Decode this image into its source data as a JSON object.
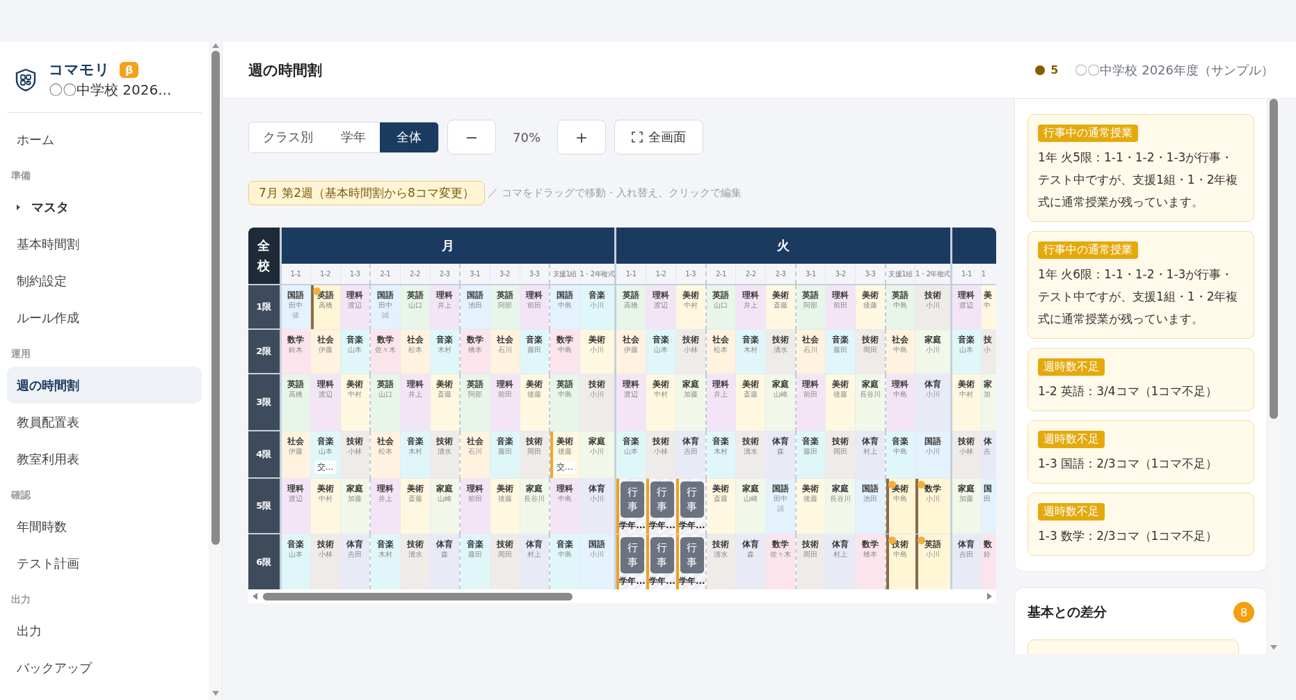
{
  "sidebar": {
    "app_name": "コマモリ",
    "badge": "β",
    "school": "〇〇中学校 2026...",
    "items": [
      {
        "kind": "link",
        "label": "ホーム",
        "selected": false
      },
      {
        "kind": "section",
        "label": "準備"
      },
      {
        "kind": "group",
        "label": "マスタ",
        "expanded": false,
        "selected": false
      },
      {
        "kind": "link",
        "label": "基本時間割",
        "selected": false
      },
      {
        "kind": "link",
        "label": "制約設定",
        "selected": false
      },
      {
        "kind": "link",
        "label": "ルール作成",
        "selected": false
      },
      {
        "kind": "section",
        "label": "運用"
      },
      {
        "kind": "link",
        "label": "週の時間割",
        "selected": true
      },
      {
        "kind": "link",
        "label": "教員配置表",
        "selected": false
      },
      {
        "kind": "link",
        "label": "教室利用表",
        "selected": false
      },
      {
        "kind": "section",
        "label": "確認"
      },
      {
        "kind": "link",
        "label": "年間時数",
        "selected": false
      },
      {
        "kind": "link",
        "label": "テスト計画",
        "selected": false
      },
      {
        "kind": "section",
        "label": "出力"
      },
      {
        "kind": "link",
        "label": "出力",
        "selected": false
      },
      {
        "kind": "link",
        "label": "バックアップ",
        "selected": false
      }
    ]
  },
  "header": {
    "title": "週の時間割",
    "warning_count": "5",
    "school": "〇〇中学校 2026年度（サンプル）"
  },
  "view_modes": [
    {
      "label": "クラス別",
      "selected": false
    },
    {
      "label": "学年",
      "selected": false
    },
    {
      "label": "全体",
      "selected": true
    }
  ],
  "zoom": {
    "decrease": "−",
    "value": "70%",
    "increase": "+"
  },
  "fullscreen_button": "全画面",
  "week_label": "7月 第2週（基本時間割から8コマ変更）",
  "hint": "／ コマをドラッグで移動・入れ替え、クリックで編集",
  "timetable": {
    "corner": "全校",
    "periods": [
      "1限",
      "2限",
      "3限",
      "4限",
      "5限",
      "6限"
    ],
    "days": [
      {
        "label": "月",
        "groups": [
          [
            {
              "class": "1-1",
              "cells": [
                {
                  "kind": "lesson",
                  "subject": "国語",
                  "teacher": "田中",
                  "note": "健",
                  "color": "#e3f2fd",
                  "marked": false
                },
                {
                  "kind": "lesson",
                  "subject": "数学",
                  "teacher": "鈴木",
                  "color": "#fce4ec",
                  "marked": false
                },
                {
                  "kind": "lesson",
                  "subject": "英語",
                  "teacher": "高橋",
                  "color": "#e8f5e9",
                  "marked": false
                },
                {
                  "kind": "lesson",
                  "subject": "社会",
                  "teacher": "伊藤",
                  "color": "#fff3e0",
                  "marked": false
                },
                {
                  "kind": "lesson",
                  "subject": "理科",
                  "teacher": "渡辺",
                  "color": "#f3e5f5",
                  "marked": false
                },
                {
                  "kind": "lesson",
                  "subject": "音楽",
                  "teacher": "山本",
                  "color": "#e0f7fa",
                  "marked": false
                }
              ]
            },
            {
              "class": "1-2",
              "cells": [
                {
                  "kind": "lesson",
                  "subject": "英語",
                  "teacher": "高橋",
                  "color": "#fff6d6",
                  "marked": true,
                  "edited": true
                },
                {
                  "kind": "lesson",
                  "subject": "社会",
                  "teacher": "伊藤",
                  "color": "#fff3e0",
                  "marked": false
                },
                {
                  "kind": "lesson",
                  "subject": "理科",
                  "teacher": "渡辺",
                  "color": "#f3e5f5",
                  "marked": false
                },
                {
                  "kind": "lesson",
                  "subject": "音楽",
                  "teacher": "山本",
                  "chip": "交...",
                  "color": "#e0f7fa",
                  "marked": false
                },
                {
                  "kind": "lesson",
                  "subject": "美術",
                  "teacher": "中村",
                  "color": "#fff8e1",
                  "marked": false
                },
                {
                  "kind": "lesson",
                  "subject": "技術",
                  "teacher": "小林",
                  "color": "#efebe9",
                  "marked": false
                }
              ]
            },
            {
              "class": "1-3",
              "cells": [
                {
                  "kind": "lesson",
                  "subject": "理科",
                  "teacher": "渡辺",
                  "color": "#f3e5f5",
                  "marked": false
                },
                {
                  "kind": "lesson",
                  "subject": "音楽",
                  "teacher": "山本",
                  "color": "#e0f7fa",
                  "marked": false
                },
                {
                  "kind": "lesson",
                  "subject": "美術",
                  "teacher": "中村",
                  "color": "#fff8e1",
                  "marked": false
                },
                {
                  "kind": "lesson",
                  "subject": "技術",
                  "teacher": "小林",
                  "color": "#efebe9",
                  "marked": false
                },
                {
                  "kind": "lesson",
                  "subject": "家庭",
                  "teacher": "加藤",
                  "color": "#f1f8e9",
                  "marked": false
                },
                {
                  "kind": "lesson",
                  "subject": "体育",
                  "teacher": "吉田",
                  "color": "#e8eaf6",
                  "marked": false
                }
              ]
            }
          ],
          [
            {
              "class": "2-1",
              "cells": [
                {
                  "kind": "lesson",
                  "subject": "国語",
                  "teacher": "田中",
                  "note": "誠",
                  "color": "#e3f2fd",
                  "marked": false
                },
                {
                  "kind": "lesson",
                  "subject": "数学",
                  "teacher": "佐々木",
                  "color": "#fce4ec",
                  "marked": false
                },
                {
                  "kind": "lesson",
                  "subject": "英語",
                  "teacher": "山口",
                  "color": "#e8f5e9",
                  "marked": false
                },
                {
                  "kind": "lesson",
                  "subject": "社会",
                  "teacher": "松本",
                  "color": "#fff3e0",
                  "marked": false
                },
                {
                  "kind": "lesson",
                  "subject": "理科",
                  "teacher": "井上",
                  "color": "#f3e5f5",
                  "marked": false
                },
                {
                  "kind": "lesson",
                  "subject": "音楽",
                  "teacher": "木村",
                  "color": "#e0f7fa",
                  "marked": false
                }
              ]
            },
            {
              "class": "2-2",
              "cells": [
                {
                  "kind": "lesson",
                  "subject": "英語",
                  "teacher": "山口",
                  "color": "#e8f5e9",
                  "marked": false
                },
                {
                  "kind": "lesson",
                  "subject": "社会",
                  "teacher": "松本",
                  "color": "#fff3e0",
                  "marked": false
                },
                {
                  "kind": "lesson",
                  "subject": "理科",
                  "teacher": "井上",
                  "color": "#f3e5f5",
                  "marked": false
                },
                {
                  "kind": "lesson",
                  "subject": "音楽",
                  "teacher": "木村",
                  "color": "#e0f7fa",
                  "marked": false
                },
                {
                  "kind": "lesson",
                  "subject": "美術",
                  "teacher": "斎藤",
                  "color": "#fff8e1",
                  "marked": false
                },
                {
                  "kind": "lesson",
                  "subject": "技術",
                  "teacher": "清水",
                  "color": "#efebe9",
                  "marked": false
                }
              ]
            },
            {
              "class": "2-3",
              "cells": [
                {
                  "kind": "lesson",
                  "subject": "理科",
                  "teacher": "井上",
                  "color": "#f3e5f5",
                  "marked": false
                },
                {
                  "kind": "lesson",
                  "subject": "音楽",
                  "teacher": "木村",
                  "color": "#e0f7fa",
                  "marked": false
                },
                {
                  "kind": "lesson",
                  "subject": "美術",
                  "teacher": "斎藤",
                  "color": "#fff8e1",
                  "marked": false
                },
                {
                  "kind": "lesson",
                  "subject": "技術",
                  "teacher": "清水",
                  "color": "#efebe9",
                  "marked": false
                },
                {
                  "kind": "lesson",
                  "subject": "家庭",
                  "teacher": "山崎",
                  "color": "#f1f8e9",
                  "marked": false
                },
                {
                  "kind": "lesson",
                  "subject": "体育",
                  "teacher": "森",
                  "color": "#e8eaf6",
                  "marked": false
                }
              ]
            }
          ],
          [
            {
              "class": "3-1",
              "cells": [
                {
                  "kind": "lesson",
                  "subject": "国語",
                  "teacher": "池田",
                  "color": "#e3f2fd",
                  "marked": false
                },
                {
                  "kind": "lesson",
                  "subject": "数学",
                  "teacher": "橋本",
                  "color": "#fce4ec",
                  "marked": false
                },
                {
                  "kind": "lesson",
                  "subject": "英語",
                  "teacher": "阿部",
                  "color": "#e8f5e9",
                  "marked": false
                },
                {
                  "kind": "lesson",
                  "subject": "社会",
                  "teacher": "石川",
                  "color": "#fff3e0",
                  "marked": false
                },
                {
                  "kind": "lesson",
                  "subject": "理科",
                  "teacher": "前田",
                  "color": "#f3e5f5",
                  "marked": false
                },
                {
                  "kind": "lesson",
                  "subject": "音楽",
                  "teacher": "藤田",
                  "color": "#e0f7fa",
                  "marked": false
                }
              ]
            },
            {
              "class": "3-2",
              "cells": [
                {
                  "kind": "lesson",
                  "subject": "英語",
                  "teacher": "阿部",
                  "color": "#e8f5e9",
                  "marked": false
                },
                {
                  "kind": "lesson",
                  "subject": "社会",
                  "teacher": "石川",
                  "color": "#fff3e0",
                  "marked": false
                },
                {
                  "kind": "lesson",
                  "subject": "理科",
                  "teacher": "前田",
                  "color": "#f3e5f5",
                  "marked": false
                },
                {
                  "kind": "lesson",
                  "subject": "音楽",
                  "teacher": "藤田",
                  "color": "#e0f7fa",
                  "marked": false
                },
                {
                  "kind": "lesson",
                  "subject": "美術",
                  "teacher": "後藤",
                  "color": "#fff8e1",
                  "marked": false
                },
                {
                  "kind": "lesson",
                  "subject": "技術",
                  "teacher": "岡田",
                  "color": "#efebe9",
                  "marked": false
                }
              ]
            },
            {
              "class": "3-3",
              "cells": [
                {
                  "kind": "lesson",
                  "subject": "理科",
                  "teacher": "前田",
                  "color": "#f3e5f5",
                  "marked": false
                },
                {
                  "kind": "lesson",
                  "subject": "音楽",
                  "teacher": "藤田",
                  "color": "#e0f7fa",
                  "marked": false
                },
                {
                  "kind": "lesson",
                  "subject": "美術",
                  "teacher": "後藤",
                  "color": "#fff8e1",
                  "marked": false
                },
                {
                  "kind": "lesson",
                  "subject": "技術",
                  "teacher": "岡田",
                  "color": "#efebe9",
                  "marked": false
                },
                {
                  "kind": "lesson",
                  "subject": "家庭",
                  "teacher": "長谷川",
                  "color": "#f1f8e9",
                  "marked": false
                },
                {
                  "kind": "lesson",
                  "subject": "体育",
                  "teacher": "村上",
                  "color": "#e8eaf6",
                  "marked": false
                }
              ]
            }
          ],
          [
            {
              "class": "支援1組",
              "cells": [
                {
                  "kind": "lesson",
                  "subject": "国語",
                  "teacher": "中島",
                  "color": "#e3f2fd",
                  "marked": false
                },
                {
                  "kind": "lesson",
                  "subject": "数学",
                  "teacher": "中島",
                  "color": "#fce4ec",
                  "marked": false
                },
                {
                  "kind": "lesson",
                  "subject": "英語",
                  "teacher": "中島",
                  "color": "#e8f5e9",
                  "marked": false
                },
                {
                  "kind": "lesson",
                  "subject": "美術",
                  "teacher": "後藤",
                  "chip": "交...",
                  "color": "#fff8e1",
                  "marked": false,
                  "edited": true
                },
                {
                  "kind": "lesson",
                  "subject": "理科",
                  "teacher": "中島",
                  "color": "#f3e5f5",
                  "marked": false
                },
                {
                  "kind": "lesson",
                  "subject": "音楽",
                  "teacher": "中島",
                  "color": "#e0f7fa",
                  "marked": false
                }
              ]
            },
            {
              "class": "1・2年複式",
              "cells": [
                {
                  "kind": "lesson",
                  "subject": "音楽",
                  "teacher": "小川",
                  "color": "#e0f7fa",
                  "marked": false
                },
                {
                  "kind": "lesson",
                  "subject": "美術",
                  "teacher": "小川",
                  "color": "#fff8e1",
                  "marked": false
                },
                {
                  "kind": "lesson",
                  "subject": "技術",
                  "teacher": "小川",
                  "color": "#efebe9",
                  "marked": false
                },
                {
                  "kind": "lesson",
                  "subject": "家庭",
                  "teacher": "小川",
                  "color": "#f1f8e9",
                  "marked": false
                },
                {
                  "kind": "lesson",
                  "subject": "体育",
                  "teacher": "小川",
                  "color": "#e8eaf6",
                  "marked": false
                },
                {
                  "kind": "lesson",
                  "subject": "国語",
                  "teacher": "小川",
                  "color": "#e3f2fd",
                  "marked": false
                }
              ]
            }
          ]
        ]
      },
      {
        "label": "火",
        "groups": [
          [
            {
              "class": "1-1",
              "cells": [
                {
                  "kind": "lesson",
                  "subject": "英語",
                  "teacher": "高橋",
                  "color": "#e8f5e9",
                  "marked": false
                },
                {
                  "kind": "lesson",
                  "subject": "社会",
                  "teacher": "伊藤",
                  "color": "#fff3e0",
                  "marked": false
                },
                {
                  "kind": "lesson",
                  "subject": "理科",
                  "teacher": "渡辺",
                  "color": "#f3e5f5",
                  "marked": false
                },
                {
                  "kind": "lesson",
                  "subject": "音楽",
                  "teacher": "山本",
                  "color": "#e0f7fa",
                  "marked": false
                },
                {
                  "kind": "event",
                  "label": "行事",
                  "caption": "学年..."
                },
                {
                  "kind": "event",
                  "label": "行事",
                  "caption": "学年..."
                }
              ]
            },
            {
              "class": "1-2",
              "cells": [
                {
                  "kind": "lesson",
                  "subject": "理科",
                  "teacher": "渡辺",
                  "color": "#f3e5f5",
                  "marked": false
                },
                {
                  "kind": "lesson",
                  "subject": "音楽",
                  "teacher": "山本",
                  "color": "#e0f7fa",
                  "marked": false
                },
                {
                  "kind": "lesson",
                  "subject": "美術",
                  "teacher": "中村",
                  "color": "#fff8e1",
                  "marked": false
                },
                {
                  "kind": "lesson",
                  "subject": "技術",
                  "teacher": "小林",
                  "color": "#efebe9",
                  "marked": false
                },
                {
                  "kind": "event",
                  "label": "行事",
                  "caption": "学年..."
                },
                {
                  "kind": "event",
                  "label": "行事",
                  "caption": "学年..."
                }
              ]
            },
            {
              "class": "1-3",
              "cells": [
                {
                  "kind": "lesson",
                  "subject": "美術",
                  "teacher": "中村",
                  "color": "#fff8e1",
                  "marked": false
                },
                {
                  "kind": "lesson",
                  "subject": "技術",
                  "teacher": "小林",
                  "color": "#efebe9",
                  "marked": false
                },
                {
                  "kind": "lesson",
                  "subject": "家庭",
                  "teacher": "加藤",
                  "color": "#f1f8e9",
                  "marked": false
                },
                {
                  "kind": "lesson",
                  "subject": "体育",
                  "teacher": "吉田",
                  "color": "#e8eaf6",
                  "marked": false
                },
                {
                  "kind": "event",
                  "label": "行事",
                  "caption": "学年..."
                },
                {
                  "kind": "event",
                  "label": "行事",
                  "caption": "学年..."
                }
              ]
            }
          ],
          [
            {
              "class": "2-1",
              "cells": [
                {
                  "kind": "lesson",
                  "subject": "英語",
                  "teacher": "山口",
                  "color": "#e8f5e9",
                  "marked": false
                },
                {
                  "kind": "lesson",
                  "subject": "社会",
                  "teacher": "松本",
                  "color": "#fff3e0",
                  "marked": false
                },
                {
                  "kind": "lesson",
                  "subject": "理科",
                  "teacher": "井上",
                  "color": "#f3e5f5",
                  "marked": false
                },
                {
                  "kind": "lesson",
                  "subject": "音楽",
                  "teacher": "木村",
                  "color": "#e0f7fa",
                  "marked": false
                },
                {
                  "kind": "lesson",
                  "subject": "美術",
                  "teacher": "斎藤",
                  "color": "#fff8e1",
                  "marked": false
                },
                {
                  "kind": "lesson",
                  "subject": "技術",
                  "teacher": "清水",
                  "color": "#efebe9",
                  "marked": false
                }
              ]
            },
            {
              "class": "2-2",
              "cells": [
                {
                  "kind": "lesson",
                  "subject": "理科",
                  "teacher": "井上",
                  "color": "#f3e5f5",
                  "marked": false
                },
                {
                  "kind": "lesson",
                  "subject": "音楽",
                  "teacher": "木村",
                  "color": "#e0f7fa",
                  "marked": false
                },
                {
                  "kind": "lesson",
                  "subject": "美術",
                  "teacher": "斎藤",
                  "color": "#fff8e1",
                  "marked": false
                },
                {
                  "kind": "lesson",
                  "subject": "技術",
                  "teacher": "清水",
                  "color": "#efebe9",
                  "marked": false
                },
                {
                  "kind": "lesson",
                  "subject": "家庭",
                  "teacher": "山崎",
                  "color": "#f1f8e9",
                  "marked": false
                },
                {
                  "kind": "lesson",
                  "subject": "体育",
                  "teacher": "森",
                  "color": "#e8eaf6",
                  "marked": false
                }
              ]
            },
            {
              "class": "2-3",
              "cells": [
                {
                  "kind": "lesson",
                  "subject": "美術",
                  "teacher": "斎藤",
                  "color": "#fff8e1",
                  "marked": false
                },
                {
                  "kind": "lesson",
                  "subject": "技術",
                  "teacher": "清水",
                  "color": "#efebe9",
                  "marked": false
                },
                {
                  "kind": "lesson",
                  "subject": "家庭",
                  "teacher": "山崎",
                  "color": "#f1f8e9",
                  "marked": false
                },
                {
                  "kind": "lesson",
                  "subject": "体育",
                  "teacher": "森",
                  "color": "#e8eaf6",
                  "marked": false
                },
                {
                  "kind": "lesson",
                  "subject": "国語",
                  "teacher": "田中",
                  "note": "誠",
                  "color": "#e3f2fd",
                  "marked": false
                },
                {
                  "kind": "lesson",
                  "subject": "数学",
                  "teacher": "佐々木",
                  "color": "#fce4ec",
                  "marked": false
                }
              ]
            }
          ],
          [
            {
              "class": "3-1",
              "cells": [
                {
                  "kind": "lesson",
                  "subject": "英語",
                  "teacher": "阿部",
                  "color": "#e8f5e9",
                  "marked": false
                },
                {
                  "kind": "lesson",
                  "subject": "社会",
                  "teacher": "石川",
                  "color": "#fff3e0",
                  "marked": false
                },
                {
                  "kind": "lesson",
                  "subject": "理科",
                  "teacher": "前田",
                  "color": "#f3e5f5",
                  "marked": false
                },
                {
                  "kind": "lesson",
                  "subject": "音楽",
                  "teacher": "藤田",
                  "color": "#e0f7fa",
                  "marked": false
                },
                {
                  "kind": "lesson",
                  "subject": "美術",
                  "teacher": "後藤",
                  "color": "#fff8e1",
                  "marked": false
                },
                {
                  "kind": "lesson",
                  "subject": "技術",
                  "teacher": "岡田",
                  "color": "#efebe9",
                  "marked": false
                }
              ]
            },
            {
              "class": "3-2",
              "cells": [
                {
                  "kind": "lesson",
                  "subject": "理科",
                  "teacher": "前田",
                  "color": "#f3e5f5",
                  "marked": false
                },
                {
                  "kind": "lesson",
                  "subject": "音楽",
                  "teacher": "藤田",
                  "color": "#e0f7fa",
                  "marked": false
                },
                {
                  "kind": "lesson",
                  "subject": "美術",
                  "teacher": "後藤",
                  "color": "#fff8e1",
                  "marked": false
                },
                {
                  "kind": "lesson",
                  "subject": "技術",
                  "teacher": "岡田",
                  "color": "#efebe9",
                  "marked": false
                },
                {
                  "kind": "lesson",
                  "subject": "家庭",
                  "teacher": "長谷川",
                  "color": "#f1f8e9",
                  "marked": false
                },
                {
                  "kind": "lesson",
                  "subject": "体育",
                  "teacher": "村上",
                  "color": "#e8eaf6",
                  "marked": false
                }
              ]
            },
            {
              "class": "3-3",
              "cells": [
                {
                  "kind": "lesson",
                  "subject": "美術",
                  "teacher": "後藤",
                  "color": "#fff8e1",
                  "marked": false
                },
                {
                  "kind": "lesson",
                  "subject": "技術",
                  "teacher": "岡田",
                  "color": "#efebe9",
                  "marked": false
                },
                {
                  "kind": "lesson",
                  "subject": "家庭",
                  "teacher": "長谷川",
                  "color": "#f1f8e9",
                  "marked": false
                },
                {
                  "kind": "lesson",
                  "subject": "体育",
                  "teacher": "村上",
                  "color": "#e8eaf6",
                  "marked": false
                },
                {
                  "kind": "lesson",
                  "subject": "国語",
                  "teacher": "池田",
                  "color": "#e3f2fd",
                  "marked": false
                },
                {
                  "kind": "lesson",
                  "subject": "数学",
                  "teacher": "橋本",
                  "color": "#fce4ec",
                  "marked": false
                }
              ]
            }
          ],
          [
            {
              "class": "支援1組",
              "cells": [
                {
                  "kind": "lesson",
                  "subject": "英語",
                  "teacher": "中島",
                  "color": "#e8f5e9",
                  "marked": false
                },
                {
                  "kind": "lesson",
                  "subject": "社会",
                  "teacher": "中島",
                  "color": "#fff3e0",
                  "marked": false
                },
                {
                  "kind": "lesson",
                  "subject": "理科",
                  "teacher": "中島",
                  "color": "#f3e5f5",
                  "marked": false
                },
                {
                  "kind": "lesson",
                  "subject": "音楽",
                  "teacher": "中島",
                  "color": "#e0f7fa",
                  "marked": false
                },
                {
                  "kind": "lesson",
                  "subject": "美術",
                  "teacher": "中島",
                  "color": "#fff6d6",
                  "marked": true,
                  "edited": true
                },
                {
                  "kind": "lesson",
                  "subject": "技術",
                  "teacher": "中島",
                  "color": "#fff6d6",
                  "marked": true,
                  "edited": true
                }
              ]
            },
            {
              "class": "1・2年複式",
              "cells": [
                {
                  "kind": "lesson",
                  "subject": "技術",
                  "teacher": "小川",
                  "color": "#efebe9",
                  "marked": false
                },
                {
                  "kind": "lesson",
                  "subject": "家庭",
                  "teacher": "小川",
                  "color": "#f1f8e9",
                  "marked": false
                },
                {
                  "kind": "lesson",
                  "subject": "体育",
                  "teacher": "小川",
                  "color": "#e8eaf6",
                  "marked": false
                },
                {
                  "kind": "lesson",
                  "subject": "国語",
                  "teacher": "小川",
                  "color": "#e3f2fd",
                  "marked": false
                },
                {
                  "kind": "lesson",
                  "subject": "数学",
                  "teacher": "小川",
                  "color": "#fff6d6",
                  "marked": true,
                  "edited": true
                },
                {
                  "kind": "lesson",
                  "subject": "英語",
                  "teacher": "小川",
                  "color": "#fff6d6",
                  "marked": true,
                  "edited": true
                }
              ]
            }
          ]
        ]
      },
      {
        "groups": [
          [
            {
              "class": "1-1",
              "cells": [
                {
                  "kind": "lesson",
                  "subject": "理科",
                  "teacher": "渡辺",
                  "color": "#f3e5f5",
                  "marked": false
                },
                {
                  "kind": "lesson",
                  "subject": "音楽",
                  "teacher": "山本",
                  "color": "#e0f7fa",
                  "marked": false
                },
                {
                  "kind": "lesson",
                  "subject": "美術",
                  "teacher": "中村",
                  "color": "#fff8e1",
                  "marked": false
                },
                {
                  "kind": "lesson",
                  "subject": "技術",
                  "teacher": "小林",
                  "color": "#efebe9",
                  "marked": false
                },
                {
                  "kind": "lesson",
                  "subject": "家庭",
                  "teacher": "加藤",
                  "color": "#f1f8e9",
                  "marked": false
                },
                {
                  "kind": "lesson",
                  "subject": "体育",
                  "teacher": "吉田",
                  "color": "#e8eaf6",
                  "marked": false
                }
              ]
            },
            {
              "class": "1",
              "cells": [
                {
                  "kind": "lesson",
                  "subject": "美",
                  "teacher": "中",
                  "color": "#fff8e1",
                  "marked": false
                },
                {
                  "kind": "lesson",
                  "subject": "技",
                  "teacher": "小",
                  "color": "#efebe9",
                  "marked": false
                },
                {
                  "kind": "lesson",
                  "subject": "家",
                  "teacher": "加",
                  "color": "#f1f8e9",
                  "marked": false
                },
                {
                  "kind": "lesson",
                  "subject": "体",
                  "teacher": "吉",
                  "color": "#e8eaf6",
                  "marked": false
                },
                {
                  "kind": "lesson",
                  "subject": "国",
                  "teacher": "田",
                  "color": "#e3f2fd",
                  "marked": false
                },
                {
                  "kind": "lesson",
                  "subject": "数",
                  "teacher": "鈴",
                  "color": "#fce4ec",
                  "marked": false
                }
              ]
            }
          ]
        ]
      }
    ]
  },
  "warnings": [
    {
      "tag": "行事中の通常授業",
      "text": "1年 火5限：1-1・1-2・1-3が行事・テスト中ですが、支援1組・1・2年複式に通常授業が残っています。"
    },
    {
      "tag": "行事中の通常授業",
      "text": "1年 火6限：1-1・1-2・1-3が行事・テスト中ですが、支援1組・1・2年複式に通常授業が残っています。"
    },
    {
      "tag": "週時数不足",
      "text": "1-2 英語：3/4コマ（1コマ不足）"
    },
    {
      "tag": "週時数不足",
      "text": "1-3 国語：2/3コマ（1コマ不足）"
    },
    {
      "tag": "週時数不足",
      "text": "1-3 数学：2/3コマ（1コマ不足）"
    }
  ],
  "diff_panel": {
    "title": "基本との差分",
    "count": "8"
  }
}
